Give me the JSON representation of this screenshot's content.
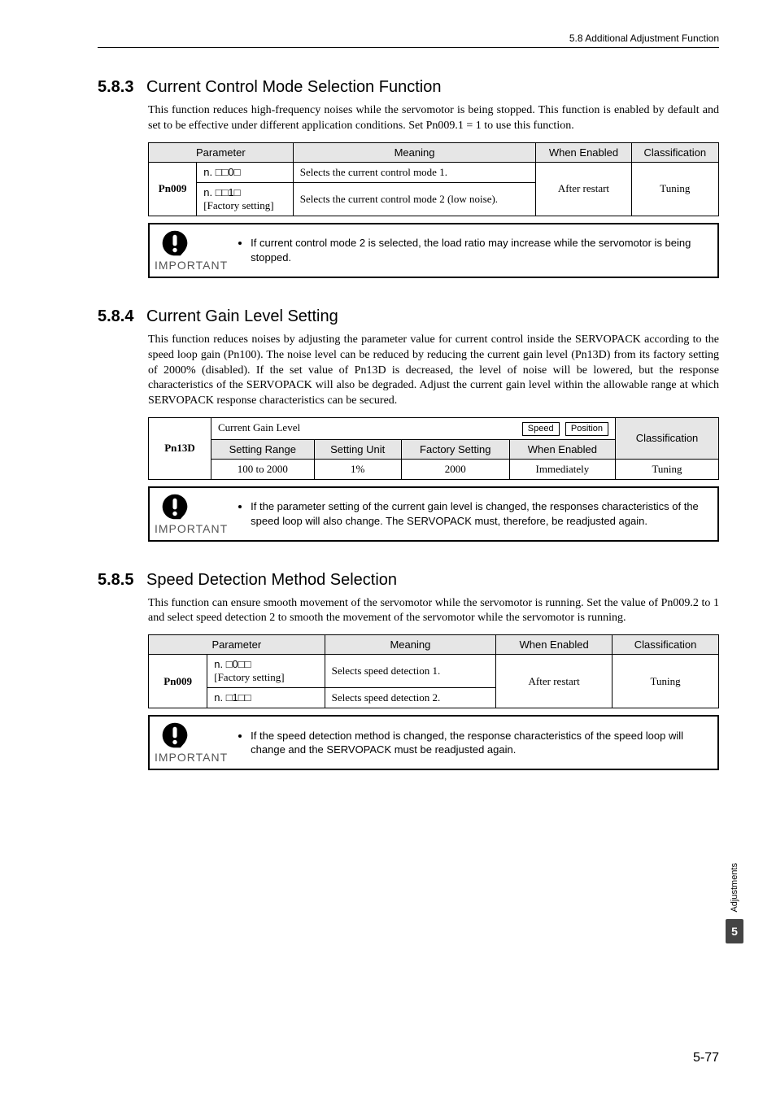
{
  "running_head": "5.8  Additional Adjustment Function",
  "sections": {
    "s583": {
      "num": "5.8.3",
      "title": "Current Control Mode Selection Function",
      "intro": "This function reduces high-frequency noises while the servomotor is being stopped. This function is enabled by default and set to be effective under different application conditions. Set Pn009.1 = 1 to use this function.",
      "table": {
        "headers": {
          "param": "Parameter",
          "meaning": "Meaning",
          "when": "When Enabled",
          "class": "Classification"
        },
        "param_id": "Pn009",
        "row1": {
          "code": "n. □□0□",
          "meaning": "Selects the current control mode 1."
        },
        "row2": {
          "code": "n. □□1□",
          "factory": "[Factory setting]",
          "meaning": "Selects the current control mode 2 (low noise)."
        },
        "when": "After restart",
        "class": "Tuning"
      },
      "important": "If current control mode 2 is selected, the load ratio may increase while the servomotor is being stopped."
    },
    "s584": {
      "num": "5.8.4",
      "title": "Current Gain Level Setting",
      "intro": "This function reduces noises by adjusting the parameter value for current control inside the SERVOPACK according to the speed loop gain (Pn100). The noise level can be reduced by reducing the current gain level (Pn13D) from its factory setting of 2000% (disabled). If the set value of Pn13D is decreased, the level of noise will be lowered, but the response characteristics of the SERVOPACK will also be degraded. Adjust the current gain level within the allowable range at which SERVOPACK response characteristics can be secured.",
      "table": {
        "param_id": "Pn13D",
        "title": "Current Gain Level",
        "modes": {
          "speed": "Speed",
          "position": "Position"
        },
        "headers": {
          "range": "Setting Range",
          "unit": "Setting Unit",
          "factory": "Factory Setting",
          "when": "When Enabled",
          "class": "Classification"
        },
        "values": {
          "range": "100 to 2000",
          "unit": "1%",
          "factory": "2000",
          "when": "Immediately",
          "class": "Tuning"
        }
      },
      "important": "If the parameter setting of the current gain level is changed, the responses characteristics of the speed loop will also change. The SERVOPACK must, therefore, be readjusted again."
    },
    "s585": {
      "num": "5.8.5",
      "title": "Speed Detection Method Selection",
      "intro": "This function can ensure smooth movement of the servomotor while the servomotor is running. Set the value of Pn009.2 to 1 and select speed detection 2 to smooth the movement of the servomotor while the servomotor is running.",
      "table": {
        "headers": {
          "param": "Parameter",
          "meaning": "Meaning",
          "when": "When Enabled",
          "class": "Classification"
        },
        "param_id": "Pn009",
        "row1": {
          "code": "n. □0□□",
          "factory": "[Factory setting]",
          "meaning": "Selects speed detection 1."
        },
        "row2": {
          "code": "n. □1□□",
          "meaning": "Selects speed detection 2."
        },
        "when": "After restart",
        "class": "Tuning"
      },
      "important": "If the speed detection method is changed, the response characteristics of the speed loop will change and the SERVOPACK must be readjusted again."
    }
  },
  "important_label": "IMPORTANT",
  "side": {
    "label": "Adjustments",
    "num": "5"
  },
  "page_number": "5-77"
}
